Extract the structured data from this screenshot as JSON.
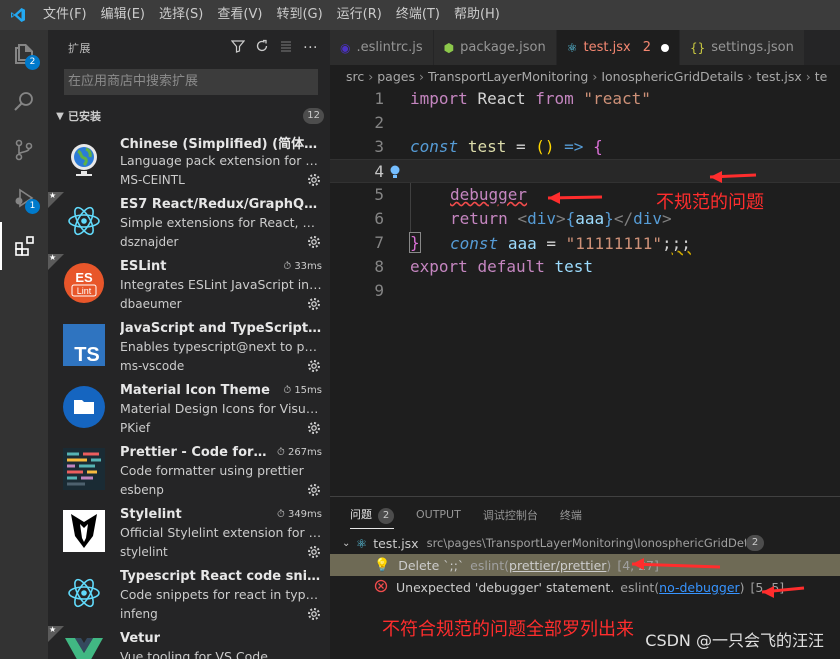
{
  "menu": [
    "文件(F)",
    "编辑(E)",
    "选择(S)",
    "查看(V)",
    "转到(G)",
    "运行(R)",
    "终端(T)",
    "帮助(H)"
  ],
  "activity": {
    "explorer_badge": "2",
    "debug_badge": "1"
  },
  "sidebar": {
    "title": "扩展",
    "search_placeholder": "在应用商店中搜索扩展",
    "installed_label": "已安装",
    "installed_count": "12",
    "extensions": [
      {
        "name": "Chinese (Simplified) (简体中...",
        "desc": "Language pack extension for Chi...",
        "publisher": "MS-CEINTL",
        "time": "",
        "starred": false,
        "icon": "globe-icon"
      },
      {
        "name": "ES7 React/Redux/GraphQL/R...",
        "desc": "Simple extensions for React, Red...",
        "publisher": "dsznajder",
        "time": "",
        "starred": true,
        "icon": "react-icon"
      },
      {
        "name": "ESLint",
        "desc": "Integrates ESLint JavaScript into ...",
        "publisher": "dbaeumer",
        "time": "33ms",
        "starred": true,
        "icon": "eslint-icon"
      },
      {
        "name": "JavaScript and TypeScript Ni...",
        "desc": "Enables typescript@next to pow...",
        "publisher": "ms-vscode",
        "time": "",
        "starred": false,
        "icon": "typescript-icon"
      },
      {
        "name": "Material Icon Theme",
        "desc": "Material Design Icons for Visual ...",
        "publisher": "PKief",
        "time": "15ms",
        "starred": false,
        "icon": "folder-icon"
      },
      {
        "name": "Prettier - Code form...",
        "desc": "Code formatter using prettier",
        "publisher": "esbenp",
        "time": "267ms",
        "starred": false,
        "icon": "prettier-icon"
      },
      {
        "name": "Stylelint",
        "desc": "Official Stylelint extension for Vis...",
        "publisher": "stylelint",
        "time": "349ms",
        "starred": false,
        "icon": "stylelint-icon"
      },
      {
        "name": "Typescript React code snippets",
        "desc": "Code snippets for react in typesc...",
        "publisher": "infeng",
        "time": "",
        "starred": false,
        "icon": "react-icon"
      },
      {
        "name": "Vetur",
        "desc": "Vue tooling for VS Code",
        "publisher": "",
        "time": "",
        "starred": true,
        "icon": "vue-icon"
      }
    ]
  },
  "editor": {
    "tabs": [
      {
        "label": ".eslintrc.js",
        "icon": "eslint-file-icon"
      },
      {
        "label": "package.json",
        "icon": "nodejs-file-icon"
      },
      {
        "label": "test.jsx",
        "icon": "react-file-icon",
        "count": "2",
        "active": true
      },
      {
        "label": "settings.json",
        "icon": "json-file-icon"
      }
    ],
    "breadcrumb": [
      "src",
      "pages",
      "TransportLayerMonitoring",
      "IonosphericGridDetails",
      "test.jsx",
      "te"
    ],
    "line_numbers": [
      "1",
      "2",
      "3",
      "4",
      "5",
      "6",
      "7",
      "8",
      "9"
    ],
    "annotation_code": "不规范的问题",
    "annotation_panel": "不符合规范的问题全部罗列出来"
  },
  "panel": {
    "tabs": [
      "问题",
      "OUTPUT",
      "调试控制台",
      "终端"
    ],
    "problem_count": "2",
    "file": {
      "name": "test.jsx",
      "path": "src\\pages\\TransportLayerMonitoring\\IonosphericGridDetails",
      "count": "2"
    },
    "problems": [
      {
        "msg": "Delete `;;`",
        "src": "eslint(",
        "code": "prettier/prettier",
        "src_end": ")",
        "pos": "[4, 27]"
      },
      {
        "msg": "Unexpected 'debugger' statement.",
        "src": "eslint(",
        "code": "no-debugger",
        "src_end": ")",
        "pos": "[5, 5]"
      }
    ]
  },
  "watermark": "CSDN @一只会飞的汪汪",
  "colors": {
    "accent": "#007acc",
    "error": "#f14c4c",
    "annotation": "#ff2d2d",
    "selected_problem": "#6e6a55"
  }
}
